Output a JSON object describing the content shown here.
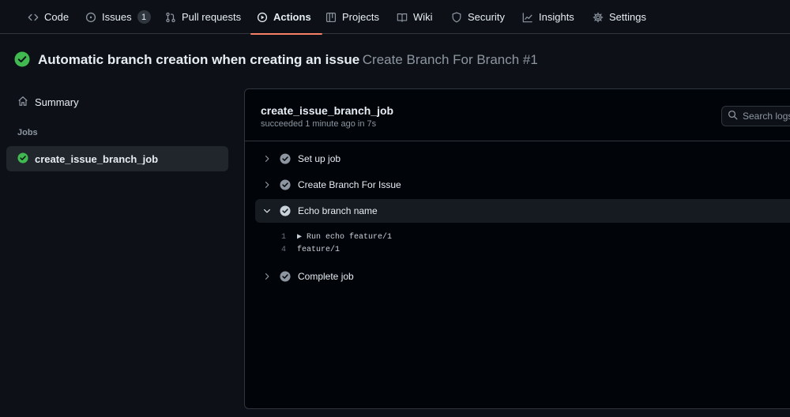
{
  "nav": {
    "tabs": [
      {
        "label": "Code",
        "icon": "code-icon"
      },
      {
        "label": "Issues",
        "icon": "issue-icon",
        "count": "1"
      },
      {
        "label": "Pull requests",
        "icon": "pull-request-icon"
      },
      {
        "label": "Actions",
        "icon": "play-icon",
        "active": true
      },
      {
        "label": "Projects",
        "icon": "table-icon"
      },
      {
        "label": "Wiki",
        "icon": "book-icon"
      },
      {
        "label": "Security",
        "icon": "shield-icon"
      },
      {
        "label": "Insights",
        "icon": "graph-icon"
      },
      {
        "label": "Settings",
        "icon": "gear-icon"
      }
    ]
  },
  "run": {
    "status": "success",
    "workflow_name": "Automatic branch creation when creating an issue",
    "run_name": "Create Branch For Branch #1"
  },
  "sidebar": {
    "summary_label": "Summary",
    "jobs_heading": "Jobs",
    "jobs": [
      {
        "label": "create_issue_branch_job",
        "status": "success"
      }
    ]
  },
  "job": {
    "title": "create_issue_branch_job",
    "meta": "succeeded 1 minute ago in 7s",
    "search_placeholder": "Search logs",
    "steps": [
      {
        "label": "Set up job",
        "expanded": false
      },
      {
        "label": "Create Branch For Issue",
        "expanded": false
      },
      {
        "label": "Echo branch name",
        "expanded": true
      },
      {
        "label": "Complete job",
        "expanded": false
      }
    ],
    "log": [
      {
        "num": "1",
        "text": "▶ Run echo feature/1"
      },
      {
        "num": "4",
        "text": "feature/1"
      }
    ]
  },
  "colors": {
    "success": "#3fb950",
    "accent_underline": "#f78166",
    "step_check": "#8d96a0"
  }
}
